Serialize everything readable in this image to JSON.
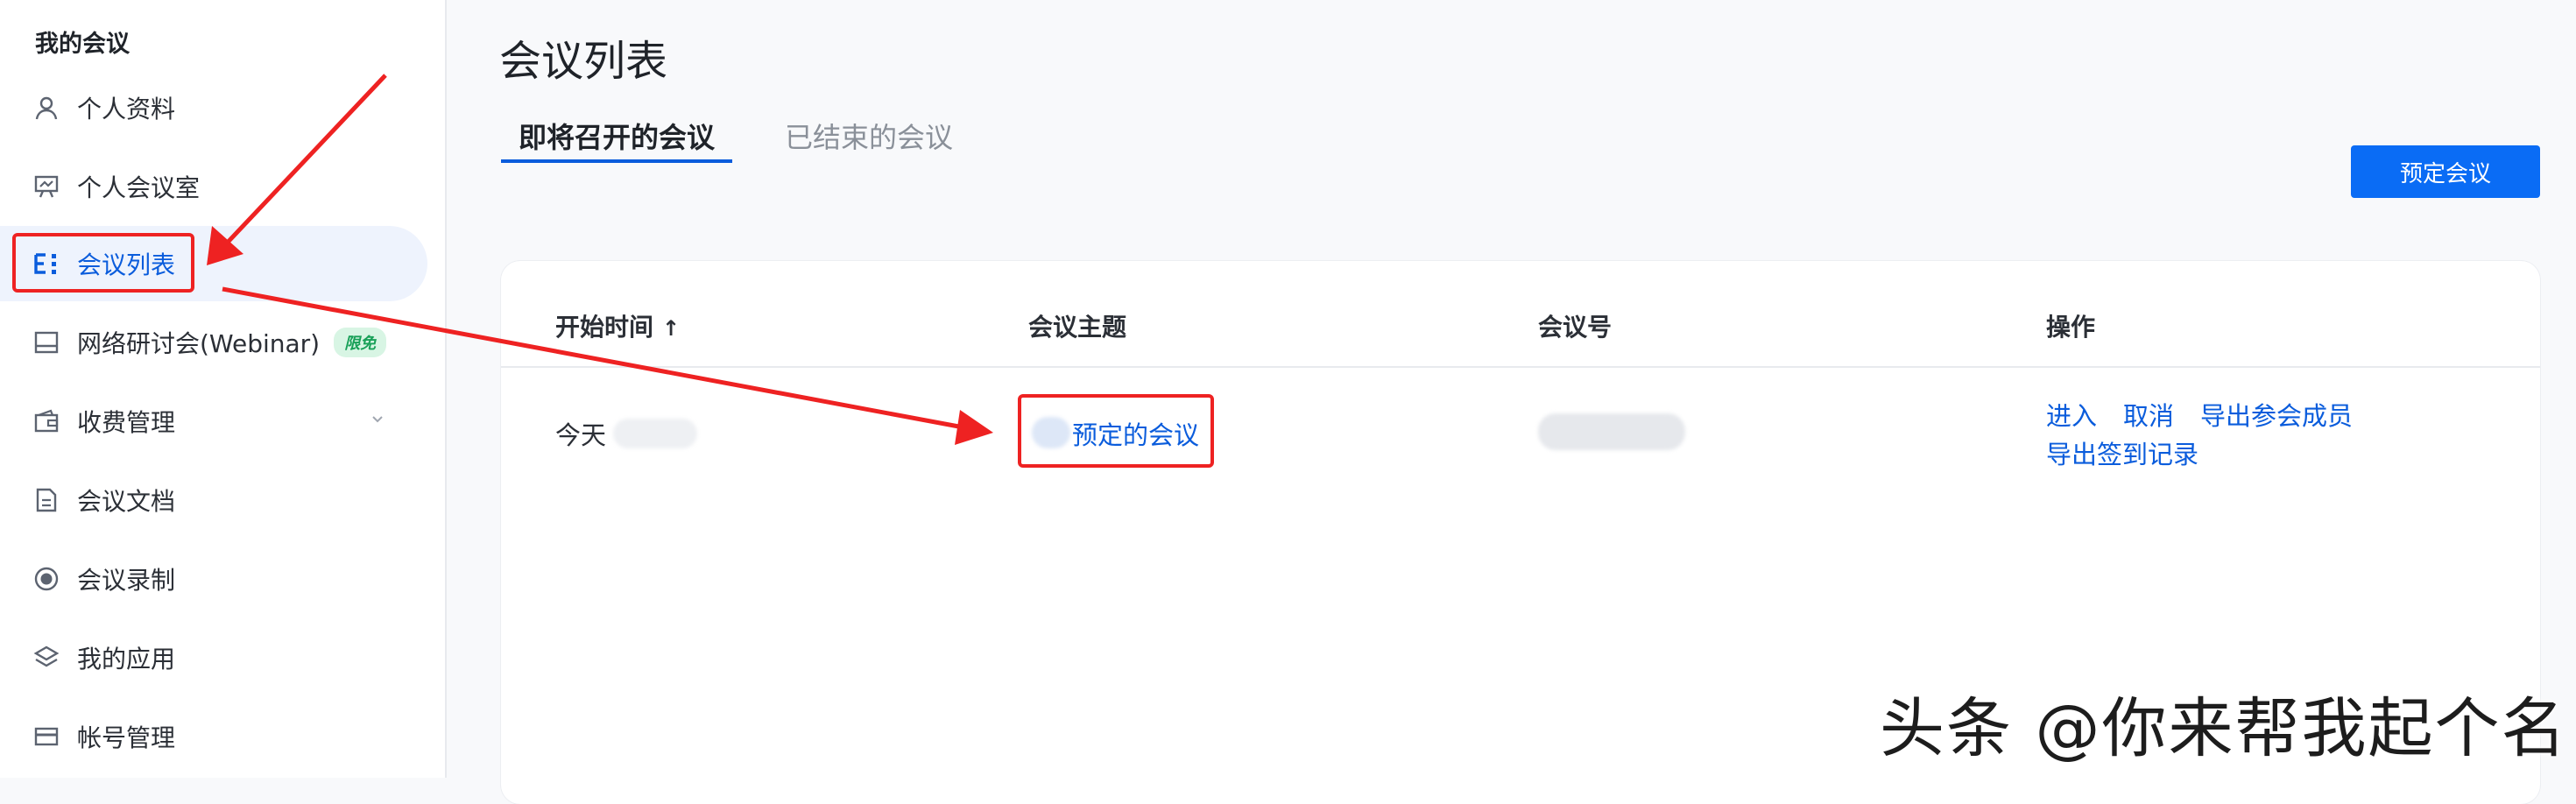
{
  "sidebar": {
    "title": "我的会议",
    "items": [
      {
        "label": "个人资料"
      },
      {
        "label": "个人会议室"
      },
      {
        "label": "会议列表"
      },
      {
        "label": "网络研讨会(Webinar)",
        "badge": "限免"
      },
      {
        "label": "收费管理"
      },
      {
        "label": "会议文档"
      },
      {
        "label": "会议录制"
      },
      {
        "label": "我的应用"
      },
      {
        "label": "帐号管理"
      }
    ]
  },
  "main": {
    "title": "会议列表",
    "tabs": [
      {
        "label": "即将召开的会议",
        "active": true
      },
      {
        "label": "已结束的会议",
        "active": false
      }
    ],
    "schedule_button": "预定会议",
    "table": {
      "headers": [
        "开始时间",
        "会议主题",
        "会议号",
        "操作"
      ],
      "sort_indicator": "↑",
      "rows": [
        {
          "start_time": "今天",
          "topic": "预定的会议",
          "actions": [
            "进入",
            "取消",
            "导出参会成员",
            "导出签到记录"
          ]
        }
      ]
    }
  },
  "watermark": "头条 @你来帮我起个名",
  "colors": {
    "accent": "#0a5cdc",
    "button": "#0a6cf5",
    "annotation": "#ee2222",
    "badge_bg": "#d8f5e4",
    "badge_text": "#18a058"
  }
}
